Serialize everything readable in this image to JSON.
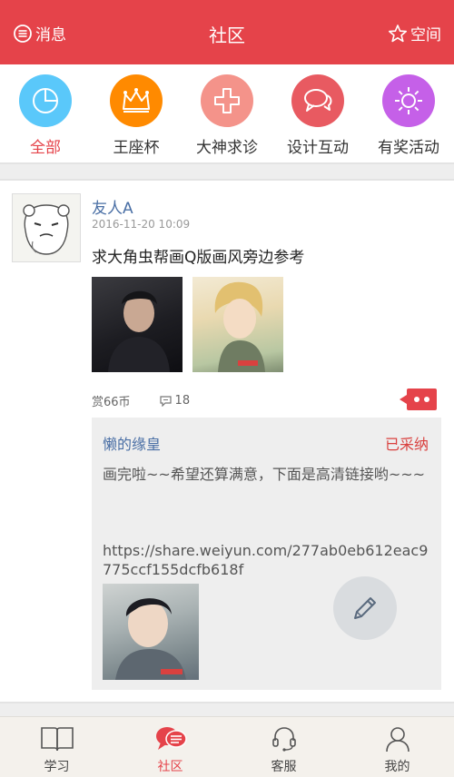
{
  "header": {
    "left_label": "消息",
    "title": "社区",
    "right_label": "空间"
  },
  "categories": [
    {
      "label": "全部",
      "color": "#5ac8fa",
      "icon": "pie-chart-icon",
      "active": true
    },
    {
      "label": "王座杯",
      "color": "#ff8a00",
      "icon": "crown-icon",
      "active": false
    },
    {
      "label": "大神求诊",
      "color": "#f4938a",
      "icon": "medical-cross-icon",
      "active": false
    },
    {
      "label": "设计互动",
      "color": "#e85a61",
      "icon": "chat-bubbles-icon",
      "active": false
    },
    {
      "label": "有奖活动",
      "color": "#c560e8",
      "icon": "sun-icon",
      "active": false
    }
  ],
  "post": {
    "author": "友人A",
    "date": "2016-11-20 10:09",
    "content": "求大角虫帮画Q版画风旁边参考",
    "reward": "赏66币",
    "comments": "18",
    "reply": {
      "author": "懒的缘皇",
      "status": "已采纳",
      "text": "画完啦~~希望还算满意，下面是高清链接哟~~~",
      "link": "https://share.weiyun.com/277ab0eb612eac9775ccf155dcfb618f"
    }
  },
  "tabbar": [
    {
      "label": "学习",
      "icon": "book-icon",
      "active": false
    },
    {
      "label": "社区",
      "icon": "chat-icon",
      "active": true
    },
    {
      "label": "客服",
      "icon": "headset-icon",
      "active": false
    },
    {
      "label": "我的",
      "icon": "person-icon",
      "active": false
    }
  ],
  "colors": {
    "accent": "#e5434a",
    "link_blue": "#4a6fa5"
  }
}
